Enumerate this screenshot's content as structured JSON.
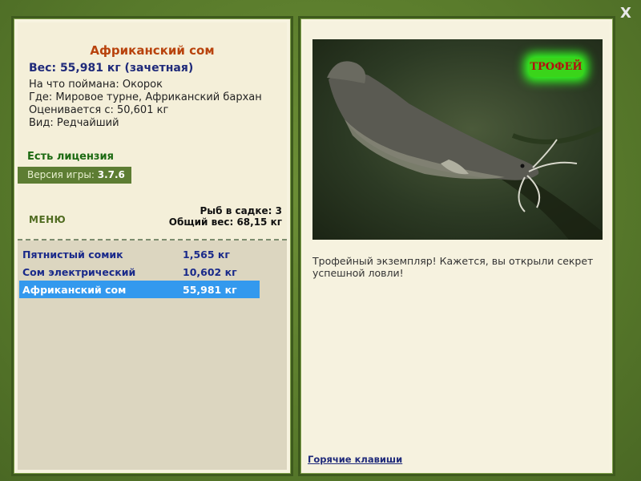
{
  "window": {
    "close_label": "X"
  },
  "fish": {
    "title": "Африканский сом",
    "weight_line": "Вес: 55,981 кг (зачетная)",
    "caught_on": "На что поймана: Окорок",
    "location": "Где: Мировое турне, Африканский бархан",
    "valued_from": "Оценивается с: 50,601 кг",
    "kind": "Вид: Редчайший"
  },
  "license": "Есть лицензия",
  "version": {
    "label": "Версия игры:",
    "number": "3.7.6"
  },
  "menu_label": "МЕНЮ",
  "keepnet": {
    "count_line": "Рыб в садке: 3",
    "total_line": "Общий вес: 68,15 кг"
  },
  "catch_list": [
    {
      "name": "Пятнистый сомик",
      "weight": "1,565 кг",
      "selected": false
    },
    {
      "name": "Сом электрический",
      "weight": "10,602 кг",
      "selected": false
    },
    {
      "name": "Африканский сом",
      "weight": "55,981 кг",
      "selected": true
    }
  ],
  "trophy_badge": "ТРОФЕЙ",
  "description": "Трофейный экземпляр! Кажется, вы открыли секрет успешной ловли!",
  "hotkeys_label": "Горячие клавиши",
  "colors": {
    "frame_green": "#587a2b",
    "title_orange": "#b8430d",
    "text_blue": "#1f2a7a",
    "selection_blue": "#3399ee",
    "license_green": "#1c6a12"
  }
}
